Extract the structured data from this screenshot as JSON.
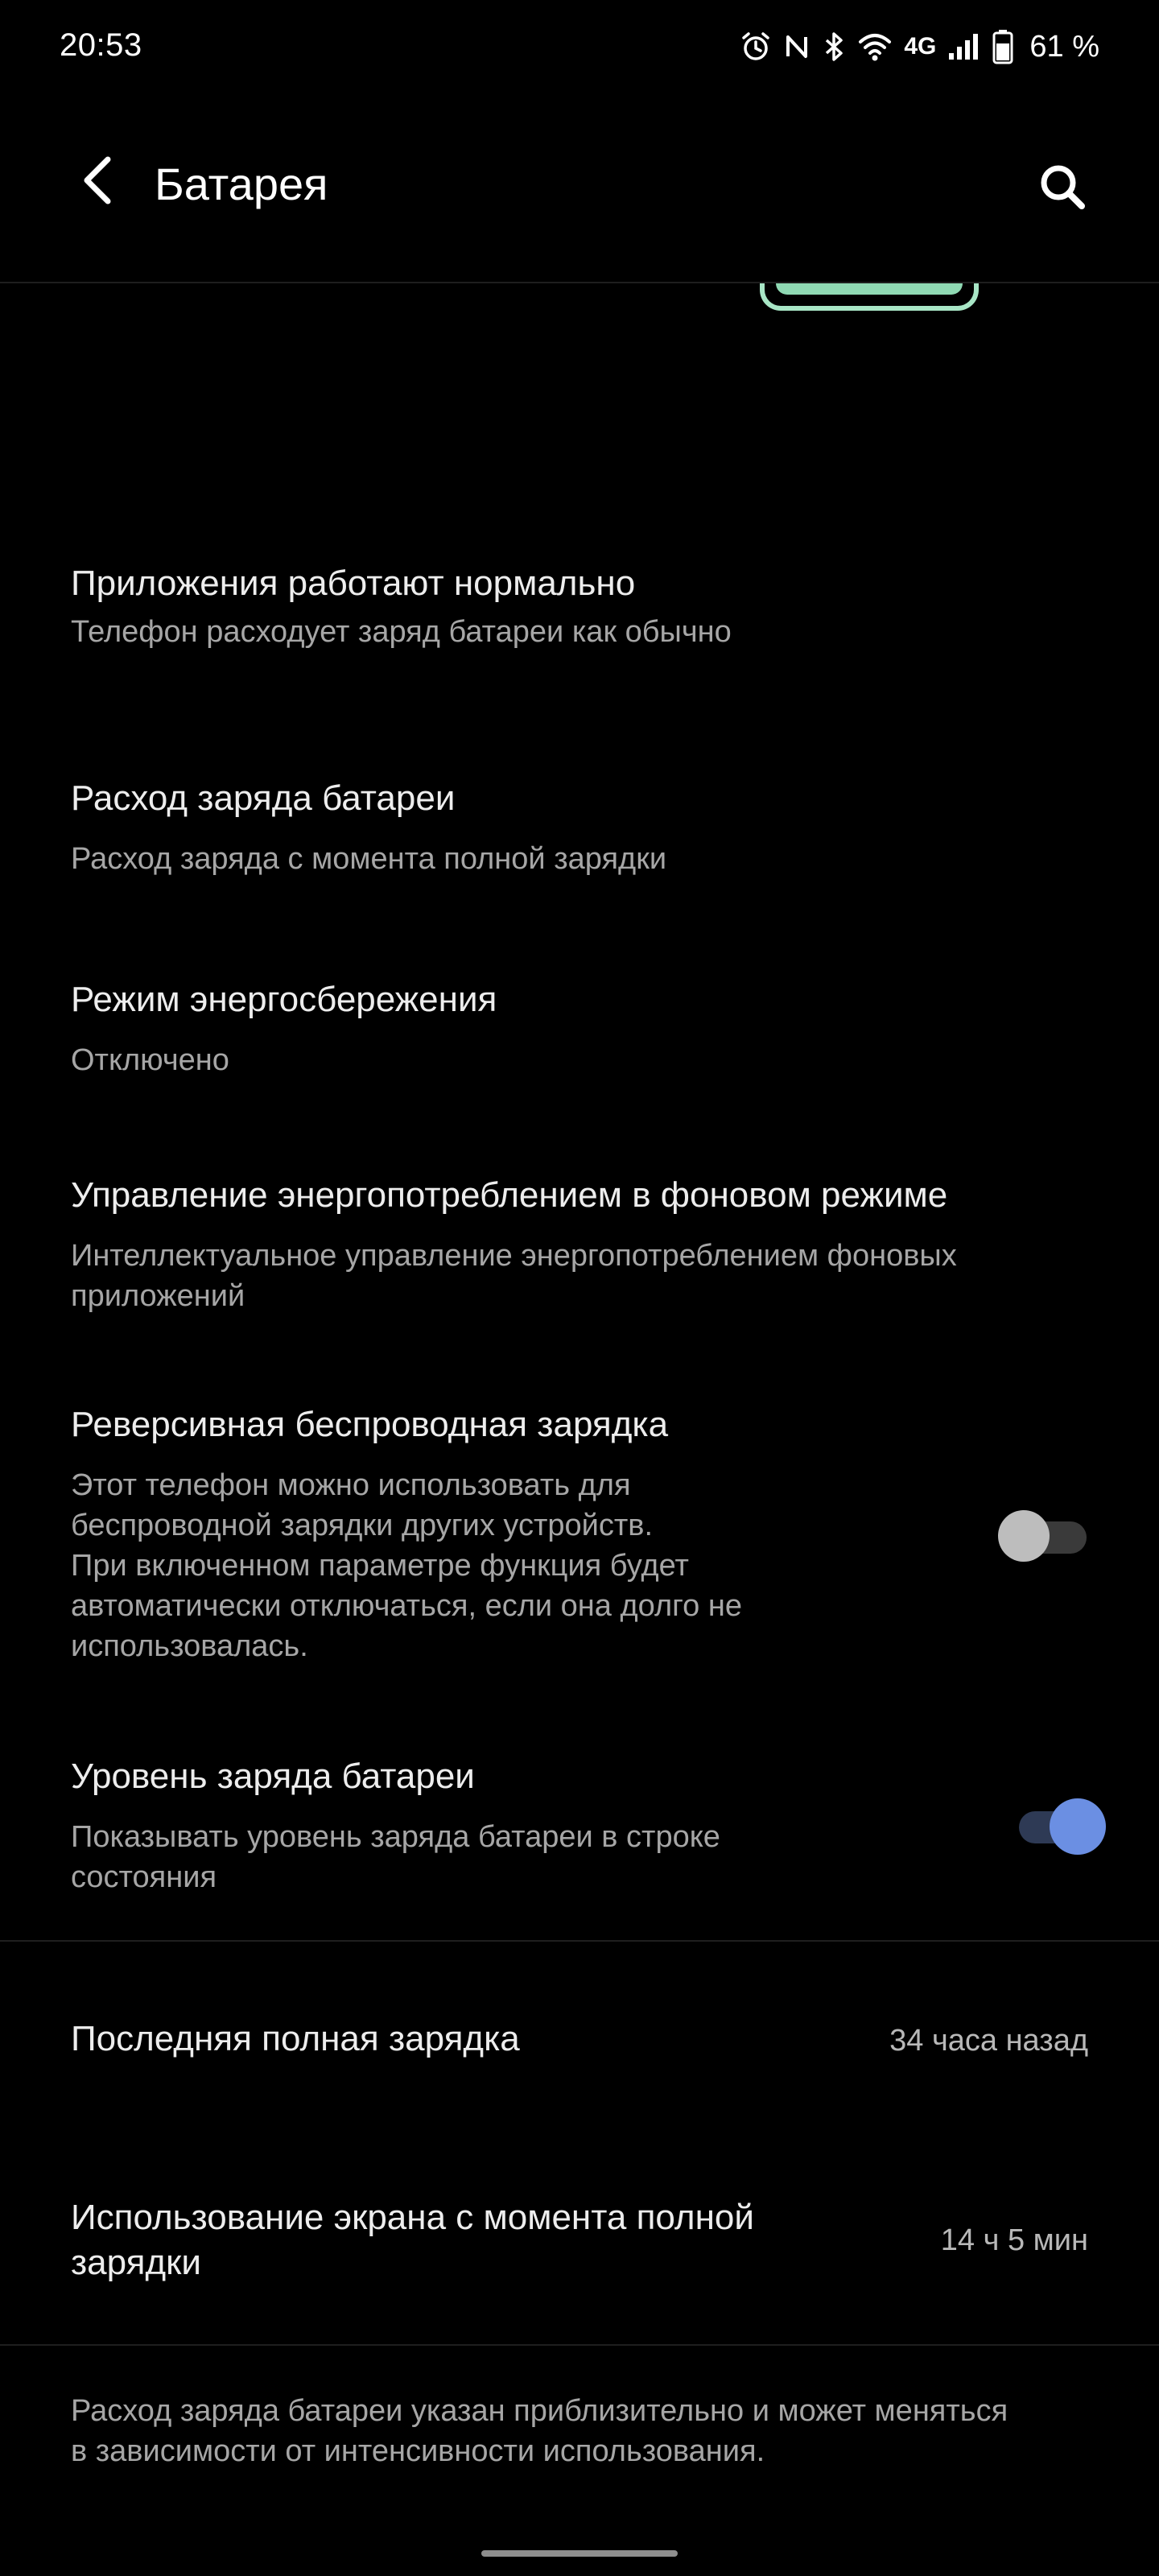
{
  "status_bar": {
    "time": "20:53",
    "network": "4G",
    "battery_percent": "61 %",
    "icons": [
      "alarm-icon",
      "nfc-icon",
      "bluetooth-icon",
      "wifi-icon",
      "cellular-signal-icon",
      "battery-icon"
    ]
  },
  "header": {
    "title": "Батарея",
    "back_icon": "back-arrow-icon",
    "search_icon": "search-icon"
  },
  "items": {
    "apps_status": {
      "title": "Приложения работают нормально",
      "subtitle": "Телефон расходует заряд батареи как обычно"
    },
    "battery_usage": {
      "title": "Расход заряда батареи",
      "subtitle": "Расход заряда с момента полной зарядки"
    },
    "power_saving": {
      "title": "Режим энергосбережения",
      "subtitle": "Отключено"
    },
    "background_power": {
      "title": "Управление энергопотреблением в фоновом режиме",
      "subtitle_line1": "Интеллектуальное управление энергопотреблением фоновых",
      "subtitle_line2": "приложений"
    },
    "reverse_wireless": {
      "title": "Реверсивная беспроводная зарядка",
      "subtitle_line1": "Этот телефон можно использовать для",
      "subtitle_line2": "беспроводной зарядки других устройств.",
      "subtitle_line3": "При включенном параметре функция будет",
      "subtitle_line4": "автоматически отключаться, если она долго не",
      "subtitle_line5": "использовалась.",
      "enabled": false
    },
    "battery_level": {
      "title": "Уровень заряда батареи",
      "subtitle_line1": "Показывать уровень заряда батареи в строке",
      "subtitle_line2": "состояния",
      "enabled": true
    },
    "last_full_charge": {
      "title": "Последняя полная зарядка",
      "value": "34 часа назад"
    },
    "screen_usage": {
      "title_line1": "Использование экрана с момента полной",
      "title_line2": "зарядки",
      "value": "14 ч 5 мин"
    }
  },
  "footer": {
    "note_line1": "Расход заряда батареи указан приблизительно и может меняться",
    "note_line2": "в зависимости от интенсивности использования."
  },
  "colors": {
    "background": "#000000",
    "accent": "#6B8FE3",
    "battery_graphic": "#A8E6C6",
    "toggle_off_thumb": "#BDBDBD",
    "toggle_off_track": "#3A3A3A",
    "toggle_on_track": "#2E3A55"
  }
}
